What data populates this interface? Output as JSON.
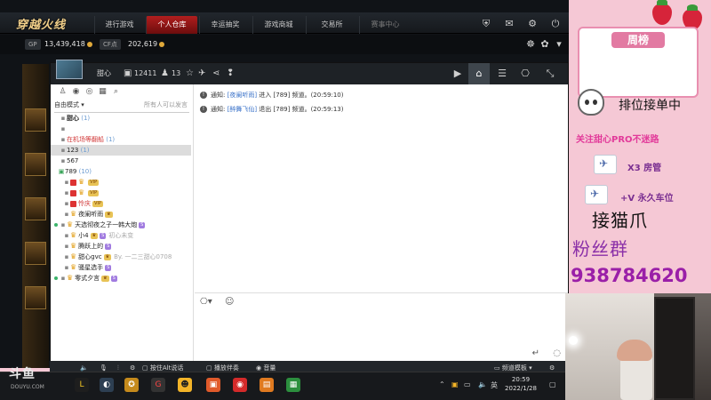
{
  "game": {
    "logo_main": "穿越火线",
    "tabs": [
      "进行游戏",
      "个人仓库",
      "幸运抽奖",
      "游戏商城",
      "交易所",
      "赛事中心"
    ],
    "active_tab_index": 1,
    "gp_label": "GP",
    "gp_value": "13,439,418",
    "cf_label": "CF点",
    "cf_value": "202,619",
    "bag_tab": "背包"
  },
  "chat": {
    "header": {
      "nickname": "甜心",
      "id_value": "12411",
      "member_count": "13"
    },
    "sidebar": {
      "mode_label": "自由模式 ▾",
      "mode_hint": "所有人可以发言",
      "rows": [
        {
          "text": "甜心",
          "count": "(1)"
        },
        {
          "text": "",
          "count": ""
        },
        {
          "text": "在机场等翻船",
          "count": "(1)"
        },
        {
          "text": "123",
          "count": "(1)"
        },
        {
          "text": "567",
          "count": ""
        },
        {
          "text": "789",
          "count": "(10)"
        },
        {
          "text": "",
          "count": ""
        },
        {
          "text": "",
          "count": ""
        },
        {
          "text": "怜庆",
          "count": ""
        },
        {
          "text": "夜阑听雨",
          "count": ""
        },
        {
          "text": "天选彻夜之子一韩大炮",
          "count": ""
        },
        {
          "text": "小4",
          "count": "",
          "sub": "初心未变"
        },
        {
          "text": "腾跃上的",
          "count": ""
        },
        {
          "text": "甜心gvc",
          "count": "",
          "sub": "By. 一二三甜心0708"
        },
        {
          "text": "骚星选手",
          "count": ""
        },
        {
          "text": "零式夕言",
          "count": ""
        }
      ]
    },
    "messages": [
      {
        "prefix": "通知:",
        "user": "[夜阑听雨]",
        "action": "进入 [789] 频道。",
        "time": "(20:59:10)"
      },
      {
        "prefix": "通知:",
        "user": "[醉舞飞仙]",
        "action": "退出 [789] 频道。",
        "time": "(20:59:13)"
      }
    ]
  },
  "stream_toolbar": {
    "hotkey_label": "按住Alt说话",
    "companion_label": "播放伴奏",
    "volume_label": "音量",
    "channel_mode": "频道模板"
  },
  "taskbar": {
    "time": "20:59",
    "date": "2022/1/28",
    "ime": "英"
  },
  "watermark": {
    "logo": "斗鱼",
    "site": "DOUYU.COM"
  },
  "overlay": {
    "rank_title": "周榜",
    "status": "排位接单中",
    "follow": "关注甜心PRO不迷路",
    "perk1": "X3 房管",
    "perk2": "+V 永久车位",
    "catch": "接猫爪",
    "fan_group": "粉丝群",
    "group_number": "938784620"
  },
  "colors": {
    "overlay_bg": "#f5c8d5",
    "accent_red": "#b11e1e",
    "link_blue": "#3a72c9",
    "overlay_purple": "#9a1fa8"
  }
}
